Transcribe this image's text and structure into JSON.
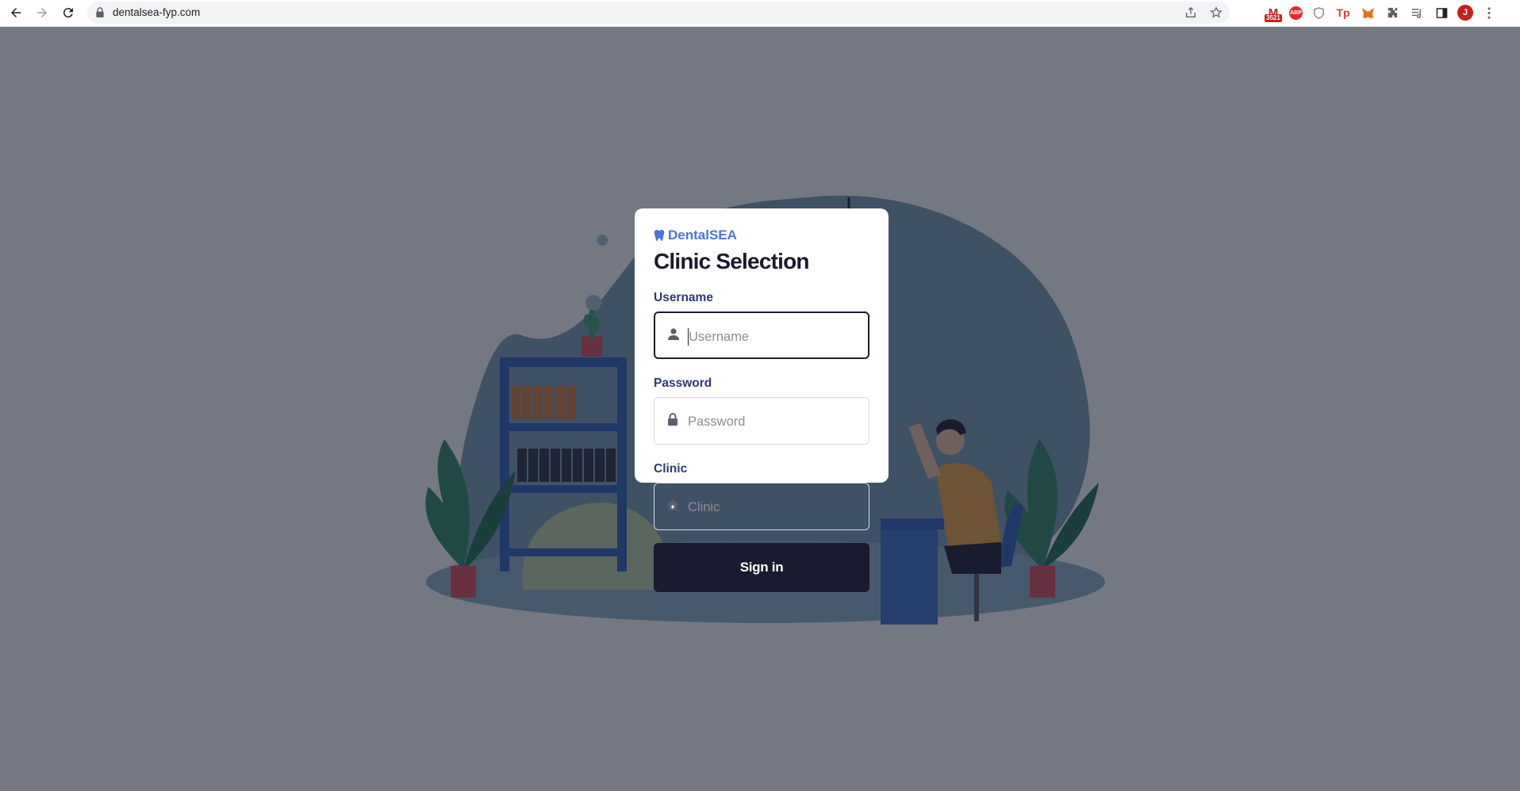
{
  "browser": {
    "url": "dentalsea-fyp.com",
    "gmail_badge": "3521",
    "gmail_letter": "M",
    "abp_label": "ABP",
    "tp_label": "Tp",
    "avatar_initial": "J"
  },
  "card": {
    "brand": "DentalSEA",
    "title": "Clinic Selection",
    "username_label": "Username",
    "username_placeholder": "Username",
    "password_label": "Password",
    "password_placeholder": "Password",
    "clinic_label": "Clinic",
    "clinic_placeholder": "Clinic",
    "signin_label": "Sign in"
  },
  "colors": {
    "brand": "#4a74e0",
    "button": "#1b1b2f",
    "label": "#2e3778",
    "backdrop": "#737680"
  }
}
